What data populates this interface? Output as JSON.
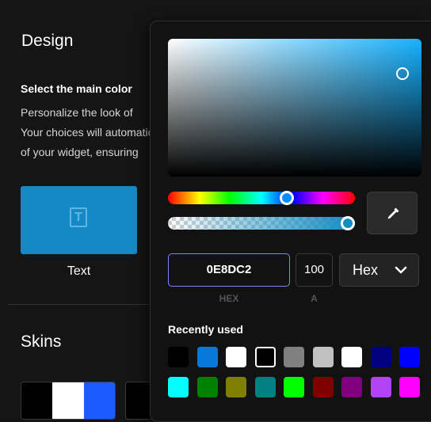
{
  "design": {
    "title": "Design",
    "section_heading": "Select the main color",
    "description_lines": [
      "Personalize the look of",
      "Your choices will automatically",
      "of your widget, ensuring"
    ],
    "tile_label": "Text",
    "tile_color": "#1589c6",
    "skins_title": "Skins"
  },
  "picker": {
    "hex_value": "0E8DC2",
    "alpha_value": "100",
    "format": "Hex",
    "hex_caption": "HEX",
    "alpha_caption": "A",
    "recent_title": "Recently used",
    "selected_color": "#0e8dc2",
    "recent_colors_row1": [
      "#000000",
      "#0a78d7",
      "#ffffff",
      "#000000",
      "#808080",
      "#c0c0c0",
      "#ffffff",
      "#000080",
      "#0000ff"
    ],
    "recent_colors_row2": [
      "#00ffff",
      "#008000",
      "#808000",
      "#008080",
      "#00ff00",
      "#800000",
      "#800080",
      "#b344f5",
      "#ff00ff"
    ]
  }
}
